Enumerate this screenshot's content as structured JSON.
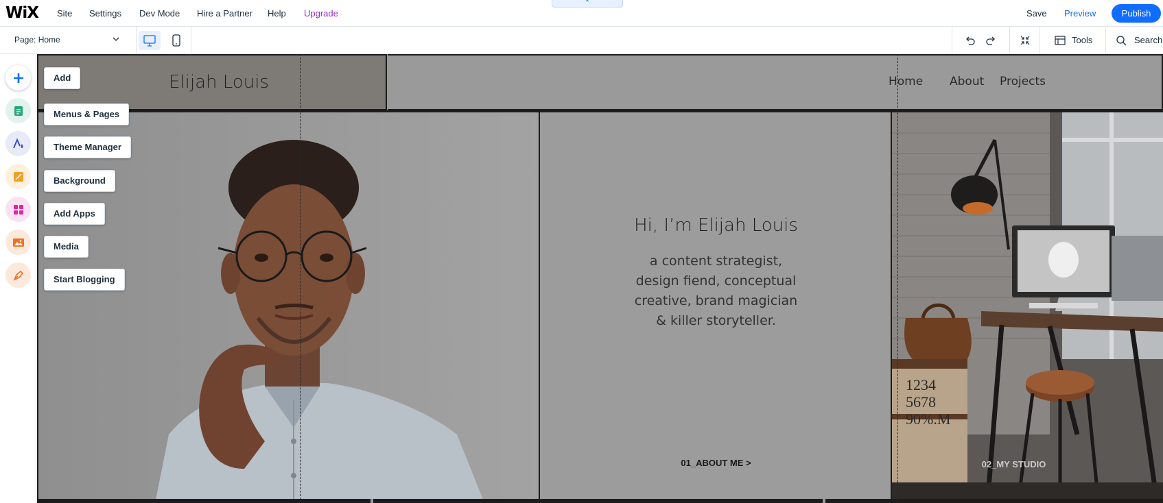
{
  "topbar": {
    "logo": "WiX",
    "menu": [
      "Site",
      "Settings",
      "Dev Mode",
      "Hire a Partner",
      "Help",
      "Upgrade"
    ],
    "collapse_label": "⌃",
    "save": "Save",
    "preview": "Preview",
    "publish": "Publish"
  },
  "toolbar": {
    "page_prefix": "Page:",
    "page_name": "Home",
    "tools": "Tools",
    "search": "Search"
  },
  "leftbar": {
    "items": [
      {
        "icon": "add-icon",
        "color": "#116dff",
        "bg": "#ffffff"
      },
      {
        "icon": "pages-icon",
        "color": "#27a57b",
        "bg": "#e1f3ec"
      },
      {
        "icon": "theme-icon",
        "color": "#3b4fbf",
        "bg": "#e8eaf8"
      },
      {
        "icon": "background-icon",
        "color": "#f0a029",
        "bg": "#fdf0dc"
      },
      {
        "icon": "apps-icon",
        "color": "#e0259f",
        "bg": "#fbe2f2"
      },
      {
        "icon": "media-icon",
        "color": "#f27121",
        "bg": "#fde8dc"
      },
      {
        "icon": "blog-icon",
        "color": "#f27121",
        "bg": "#fde8dc"
      }
    ],
    "labels": [
      "Add",
      "Menus & Pages",
      "Theme Manager",
      "Background",
      "Add Apps",
      "Media",
      "Start Blogging"
    ]
  },
  "site": {
    "title": "Elijah Louis",
    "nav": [
      "Home",
      "About",
      "Projects"
    ],
    "hero_title": "Hi, I’m Elijah Louis",
    "hero_lines": [
      "a content strategist,",
      "design fiend, conceptual",
      "creative, brand magician",
      "& killer storyteller."
    ],
    "about_link": "01_ABOUT ME  >",
    "studio_link": "02_MY STUDIO",
    "studio_numbers": [
      "1234",
      "5678",
      "90%.M"
    ]
  }
}
